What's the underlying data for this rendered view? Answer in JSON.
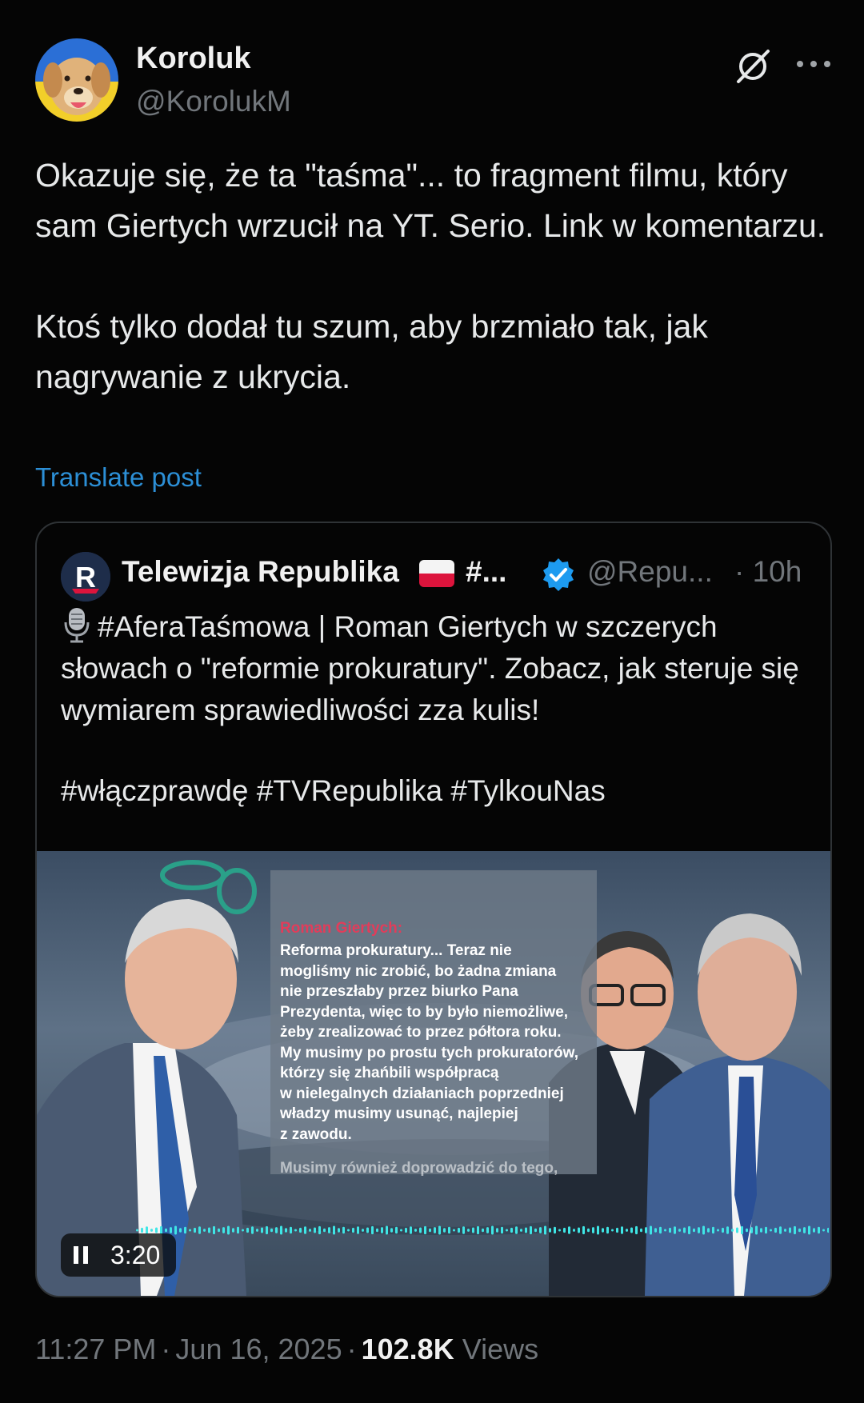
{
  "author": {
    "name": "Koroluk",
    "handle": "@KorolukM"
  },
  "post": {
    "text": "Okazuje się, że ta \"taśma\"... to fragment filmu, który sam Giertych wrzucił na YT. Serio. Link w komentarzu.\n\nKtoś tylko dodał tu szum, aby brzmiało tak, jak nagrywanie z ukrycia.",
    "translate_label": "Translate post"
  },
  "quoted": {
    "name": "Telewizja Republika",
    "name_suffix": "#...",
    "handle": "@Repu...",
    "time": "· 10h",
    "body": "#AferaTaśmowa | Roman Giertych w szczerych słowach o \"reformie prokuratury\". Zobacz, jak steruje się wymiarem sprawiedliwości zza kulis!",
    "hashtags": "#włączprawdę #TVRepublika #TylkouNas",
    "media": {
      "speaker": "Roman Giertych:",
      "quote": "Reforma prokuratury... Teraz nie\nmogliśmy nic zrobić, bo żadna zmiana\nnie przeszłaby przez biurko Pana\nPrezydenta, więc to by było niemożliwe,\nżeby zrealizować to przez półtora roku.\nMy musimy po prostu tych prokuratorów,\nktórzy się zhańbili współpracą\nw nielegalnych działaniach poprzedniej\nwładzy musimy usunąć, najlepiej\nz zawodu.",
      "quote_cut": "Musimy również doprowadzić do tego,",
      "duration": "3:20"
    }
  },
  "meta": {
    "time": "11:27 PM",
    "date": "Jun 16, 2025",
    "views_count": "102.8K",
    "views_label": "Views"
  },
  "colors": {
    "background": "#050505",
    "link": "#2c8fd6",
    "verified": "#1d9bf0",
    "muted": "#71767b",
    "waveform": "#3fe6e6"
  },
  "icons": [
    "grok-icon",
    "more-icon",
    "verified-icon",
    "mic-icon",
    "pause-icon"
  ]
}
